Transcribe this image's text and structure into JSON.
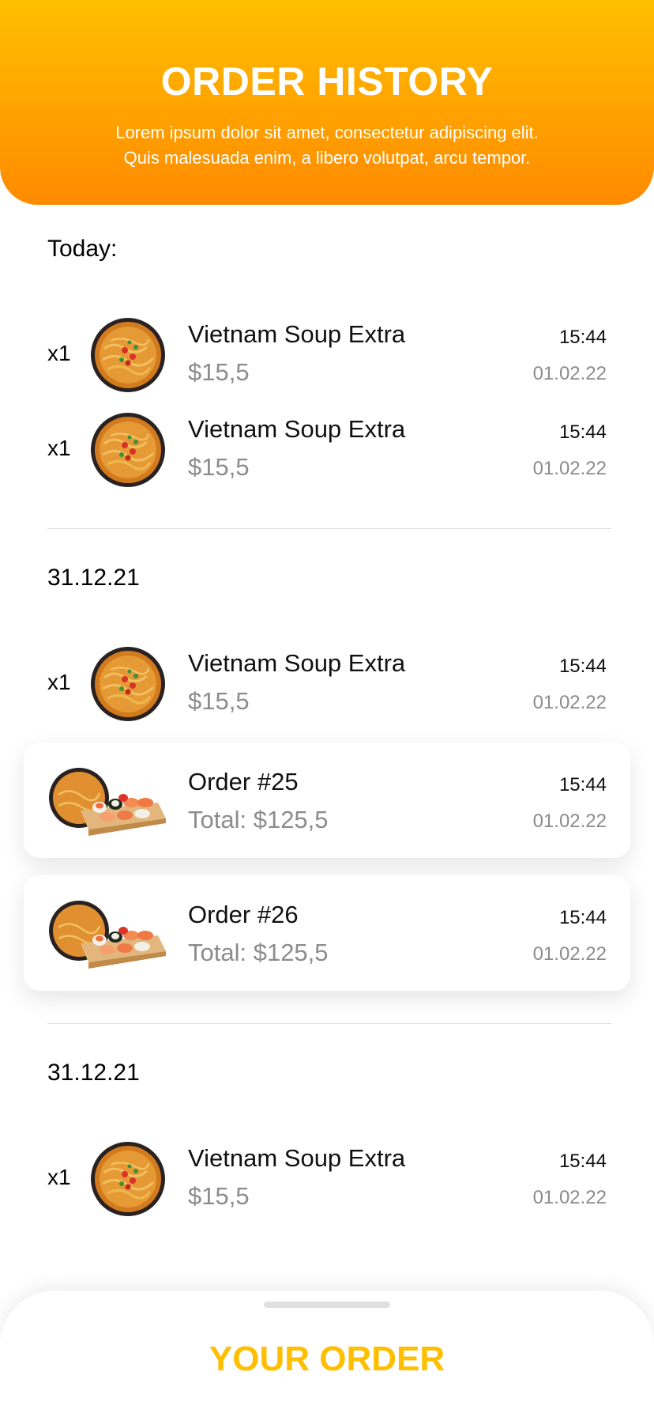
{
  "header": {
    "title": "ORDER HISTORY",
    "subtitle_line1": "Lorem ipsum dolor sit amet, consectetur adipiscing elit.",
    "subtitle_line2": "Quis malesuada enim, a libero volutpat, arcu tempor."
  },
  "sections": [
    {
      "label": "Today:",
      "items": [
        {
          "qty": "x1",
          "name": "Vietnam Soup Extra",
          "price": "$15,5",
          "time": "15:44",
          "date": "01.02.22"
        },
        {
          "qty": "x1",
          "name": "Vietnam Soup Extra",
          "price": "$15,5",
          "time": "15:44",
          "date": "01.02.22"
        }
      ]
    },
    {
      "label": "31.12.21",
      "items": [
        {
          "qty": "x1",
          "name": "Vietnam Soup Extra",
          "price": "$15,5",
          "time": "15:44",
          "date": "01.02.22"
        }
      ],
      "orders": [
        {
          "name": "Order #25",
          "total": "Total: $125,5",
          "time": "15:44",
          "date": "01.02.22"
        },
        {
          "name": "Order #26",
          "total": "Total: $125,5",
          "time": "15:44",
          "date": "01.02.22"
        }
      ]
    },
    {
      "label": "31.12.21",
      "items": [
        {
          "qty": "x1",
          "name": "Vietnam Soup Extra",
          "price": "$15,5",
          "time": "15:44",
          "date": "01.02.22"
        }
      ]
    }
  ],
  "bottom_sheet": {
    "title": "YOUR ORDER"
  },
  "colors": {
    "header_gradient_top": "#ffc000",
    "header_gradient_bottom": "#ff8a00",
    "accent": "#ffbf00",
    "muted_text": "#8c8c8c"
  },
  "icons": {
    "soup": "soup-bowl-image",
    "combo": "soup-and-sushi-image"
  }
}
